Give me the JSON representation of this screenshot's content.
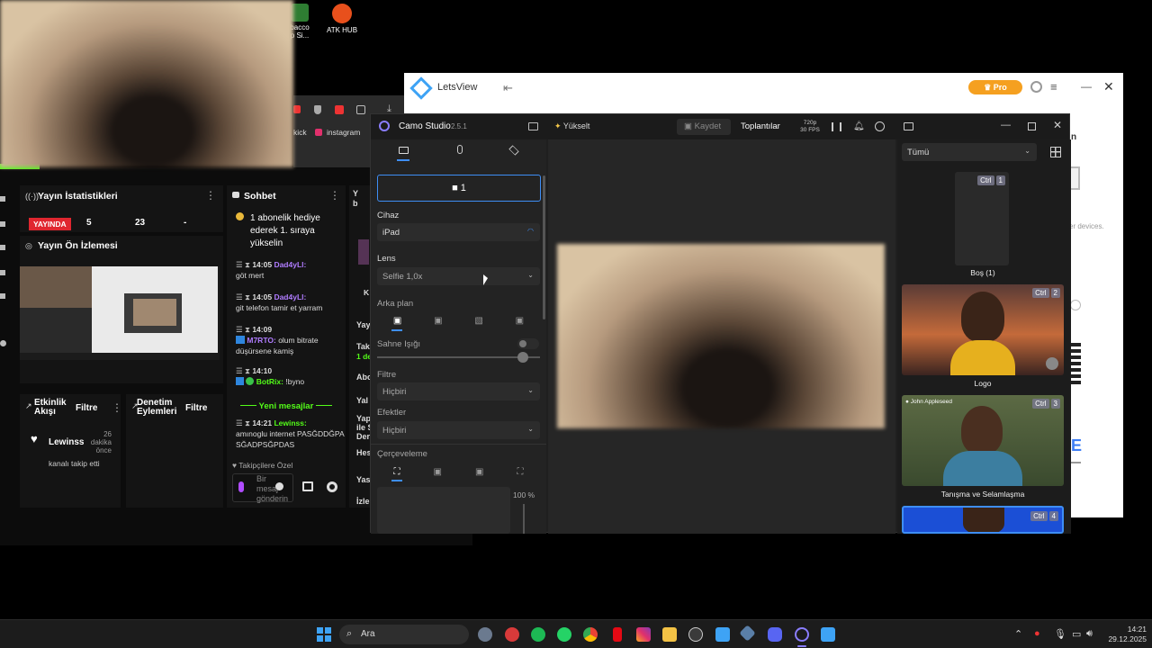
{
  "desktop": {
    "icons": [
      {
        "label": "bacco\np Si..."
      },
      {
        "label": "ATK HUB"
      }
    ]
  },
  "browser": {
    "bookmark_kick": "kick",
    "bookmark_instagram": "instagram"
  },
  "dashboard": {
    "stats_title": "Yayın İstatistikleri",
    "live_badge": "YAYINDA",
    "stat1": "5",
    "stat2": "23",
    "stat3": "-",
    "preview_title": "Yayın Ön İzlemesi",
    "activity_title": "Etkinlik Akışı",
    "activity_filter": "Filtre",
    "mod_title": "Denetim Eylemleri",
    "mod_filter": "Filtre",
    "activity_user": "Lewinss",
    "activity_time": "26 dakika önce",
    "activity_text": "kanalı takip etti",
    "chat_title": "Sohbet",
    "chat_pinned": "1 abonelik hediye ederek 1. sıraya yükselin",
    "chat_new": "Yeni mesajlar",
    "chat_messages": [
      {
        "time": "14:05",
        "user": "Dad4yLl:",
        "text": "göt mert"
      },
      {
        "time": "14:05",
        "user": "Dad4yLl:",
        "text": "git telefon tamir et yarram"
      },
      {
        "time": "14:09",
        "user": "M7RTO:",
        "text": "olum bitrate düşürsene kamiş"
      },
      {
        "time": "14:10",
        "user": "BotRix:",
        "text": "!byno"
      },
      {
        "time": "14:21",
        "user": "Lewinss:",
        "text": "amınoglu internet PASĞDDĞPASĞADPSĞPDAS"
      }
    ],
    "followers_only": "Takipçilere Özel",
    "chat_placeholder": "Bir mesaj gönderin",
    "right_col": [
      "Y",
      "b",
      "K",
      "Yay",
      "Tak",
      "1 de",
      "Abo",
      "Yal",
      "Yap",
      "ile S",
      "Der",
      "Hes",
      "Yas",
      "İzle"
    ]
  },
  "letsview": {
    "title": "LetsView",
    "pro": "Pro",
    "side_text1": "n",
    "side_text2": "er devices."
  },
  "camo": {
    "title": "Camo Studio",
    "version": "2.5.1",
    "upgrade": "Yükselt",
    "record": "Kaydet",
    "meetings": "Toplantılar",
    "resolution": "720p",
    "fps": "30 FPS",
    "camera_button": "1",
    "device_label": "Cihaz",
    "device_value": "iPad",
    "lens_label": "Lens",
    "lens_value": "Selfie 1,0x",
    "background_label": "Arka plan",
    "stage_light_label": "Sahne Işığı",
    "filter_label": "Filtre",
    "filter_value": "Hiçbiri",
    "effects_label": "Efektler",
    "effects_value": "Hiçbiri",
    "framing_label": "Çerçeveleme",
    "zoom": "100 %",
    "scene_filter": "Tümü",
    "scenes": [
      {
        "ctrl": "Ctrl",
        "key": "1",
        "caption": "Boş (1)"
      },
      {
        "ctrl": "Ctrl",
        "key": "2",
        "caption": "Logo"
      },
      {
        "ctrl": "Ctrl",
        "key": "3",
        "caption": "Tanışma ve Selamlaşma",
        "person": "John Appleseed"
      },
      {
        "ctrl": "Ctrl",
        "key": "4",
        "caption": ""
      }
    ]
  },
  "taskbar": {
    "search": "Ara",
    "time": "14:21",
    "date": "29.12.2025"
  },
  "colors": {
    "accent_green": "#53fc18",
    "live_red": "#e0262f",
    "pro_orange": "#f5a020",
    "camo_blue": "#2d62f5"
  }
}
